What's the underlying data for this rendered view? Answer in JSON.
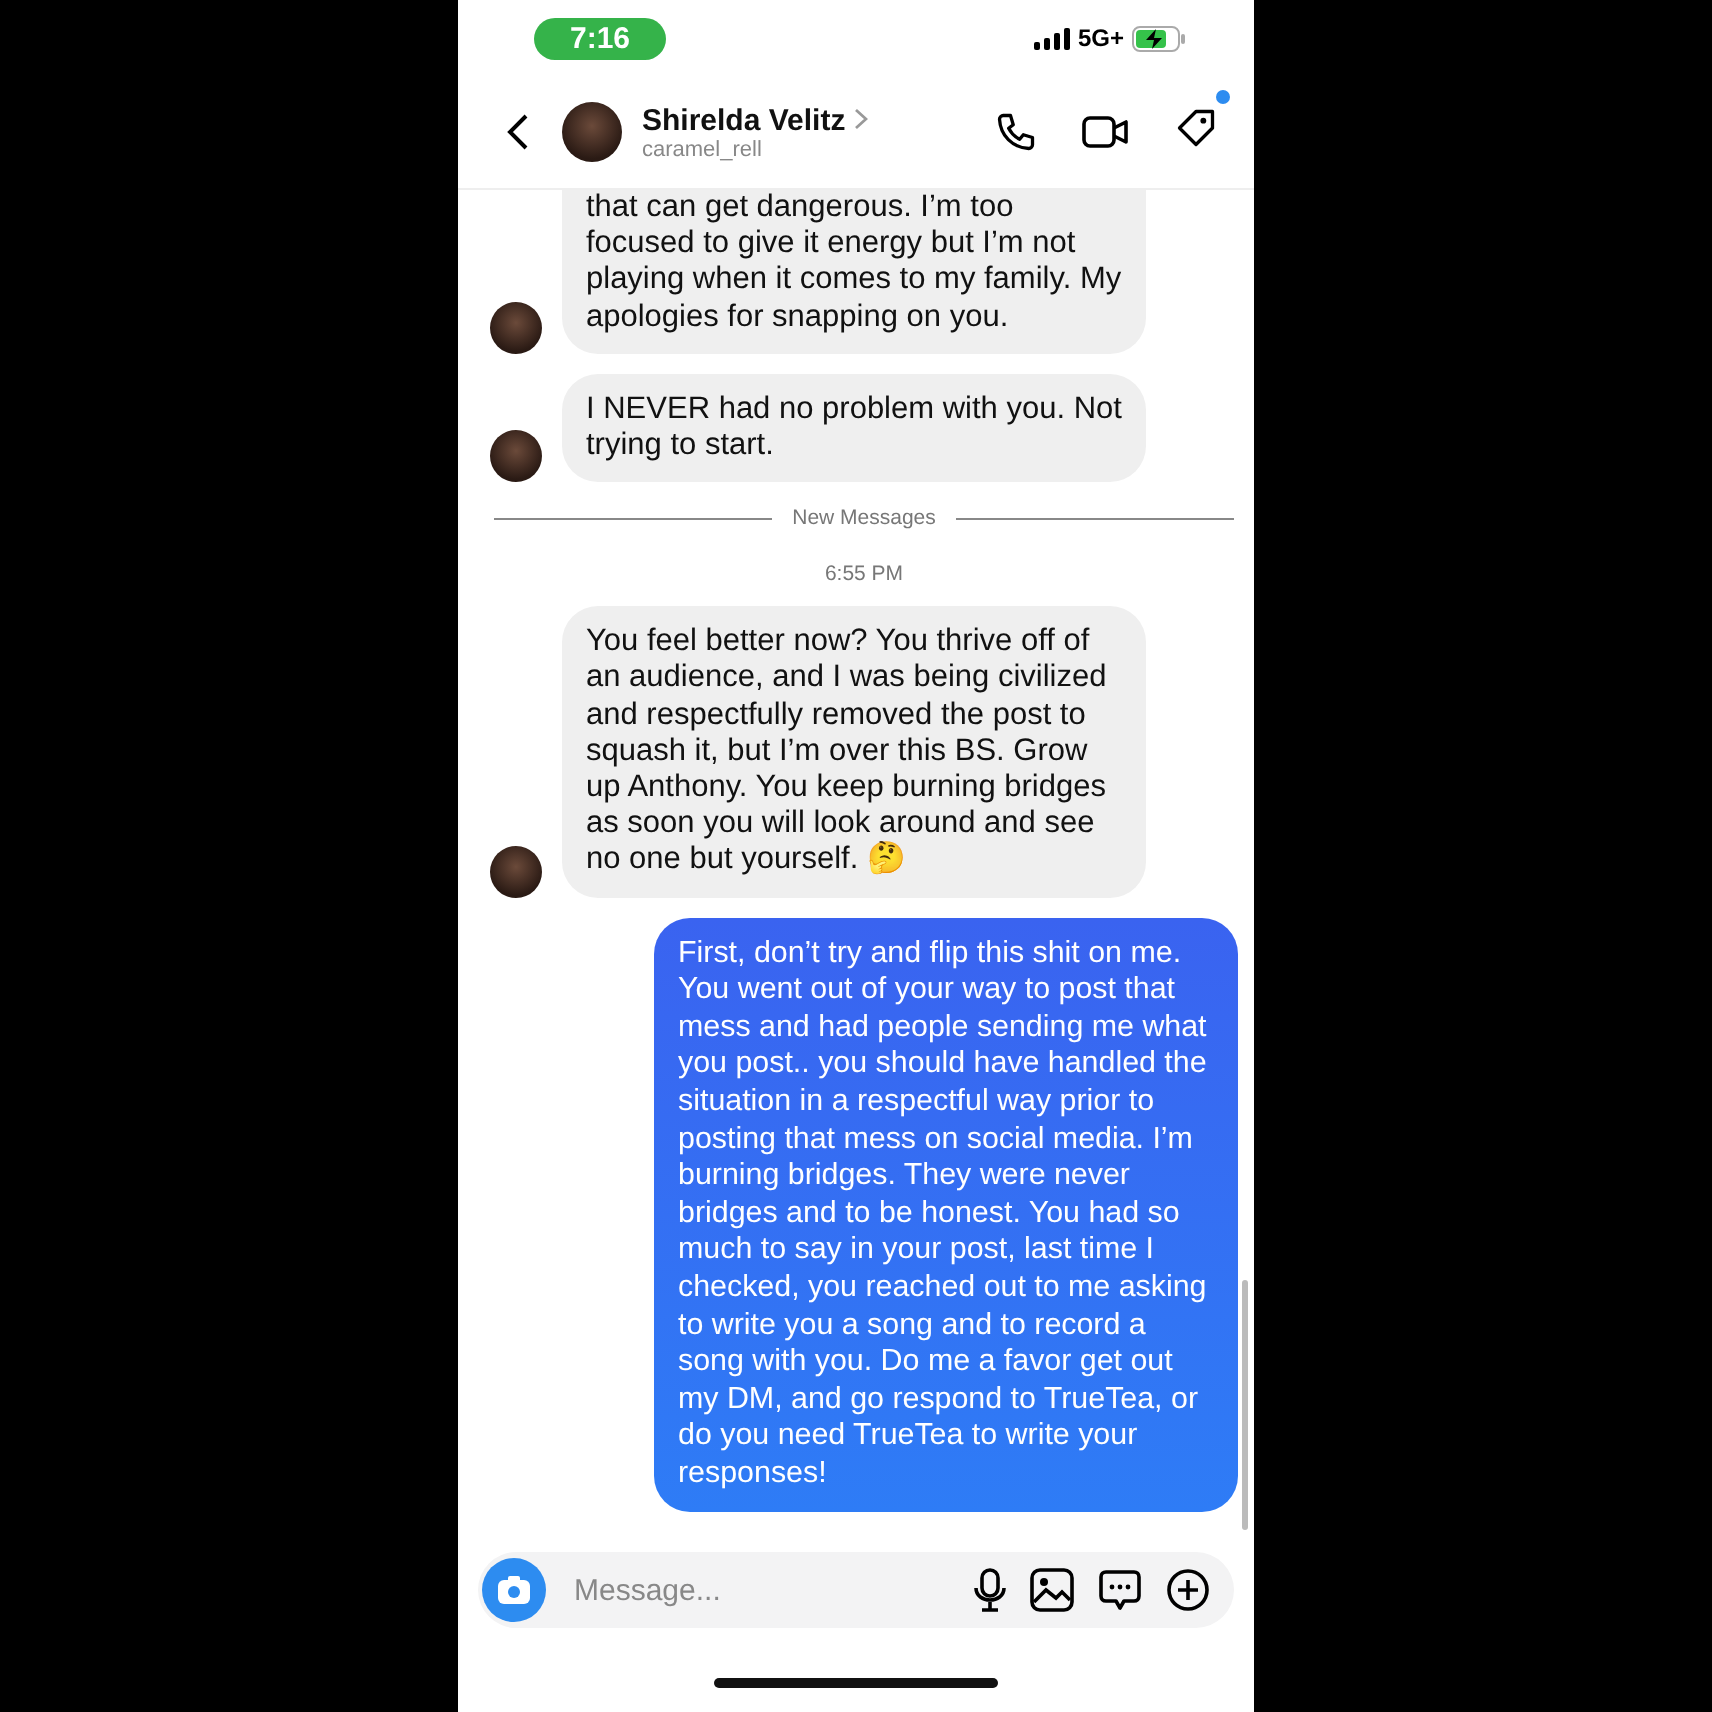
{
  "status_bar": {
    "time": "7:16",
    "network": "5G+"
  },
  "header": {
    "name": "Shirelda Velitz",
    "username": "caramel_rell",
    "notification_dot": true
  },
  "messages": [
    {
      "kind": "received",
      "text": "that can get dangerous. I’m too focused to give it energy but I’m not playing when it comes to my family. My apologies for snapping on you."
    },
    {
      "kind": "received",
      "text": "I NEVER had no problem with you. Not trying to start."
    },
    {
      "kind": "divider",
      "text": "New Messages"
    },
    {
      "kind": "timestamp",
      "text": "6:55 PM"
    },
    {
      "kind": "received",
      "text": "You feel better now? You thrive off of an audience, and I was being civilized and respectfully removed the post to squash it, but I’m over this BS. Grow up Anthony. You keep burning bridges as soon you will look around and see no one but yourself. 🤔"
    },
    {
      "kind": "sent",
      "text": "First, don’t try and flip this shit on me. You went out of your way to post that mess and had people sending me what you post.. you should have handled the situation in a respectful way prior to posting that mess on social media. I’m burning bridges. They were never bridges and to be honest. You had so much to say in your post, last time I checked, you reached out to me asking to write you a song and to record a song with you. Do me a favor get out my DM, and go respond to TrueTea, or do you need TrueTea to write your responses!"
    }
  ],
  "composer": {
    "placeholder": "Message..."
  }
}
